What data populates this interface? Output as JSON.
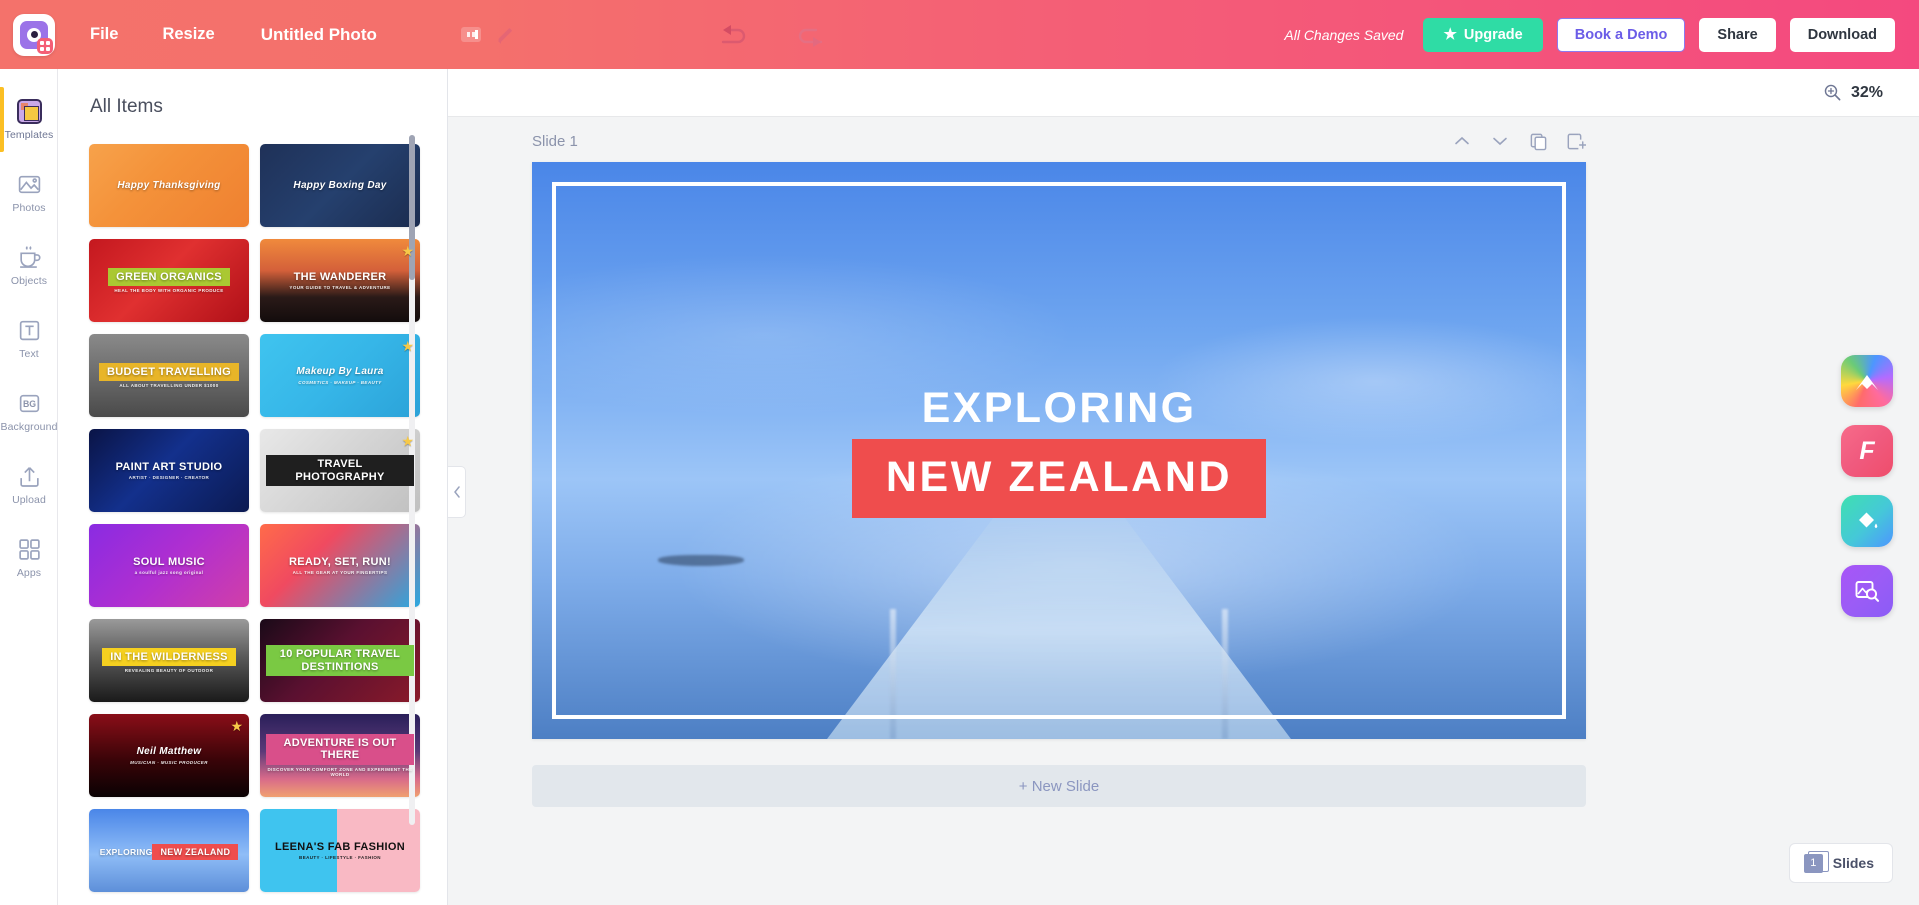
{
  "app": {
    "brand_color": "#f4597a",
    "logo_icon": "app-logo-icon"
  },
  "topbar": {
    "menu": [
      {
        "label": "File",
        "name": "menu-file"
      },
      {
        "label": "Resize",
        "name": "menu-resize"
      }
    ],
    "document_title": "Untitled Photo",
    "icons": {
      "film": "film-icon",
      "pencil": "pencil-icon",
      "undo": "undo-icon",
      "redo": "redo-icon"
    },
    "saved_status": "All Changes Saved",
    "upgrade_label": "Upgrade",
    "upgrade_star": "★",
    "demo_label": "Book a Demo",
    "share_label": "Share",
    "download_label": "Download"
  },
  "sidebar": {
    "items": [
      {
        "label": "Templates",
        "icon": "templates-icon",
        "active": true
      },
      {
        "label": "Photos",
        "icon": "photos-icon",
        "active": false
      },
      {
        "label": "Objects",
        "icon": "objects-icon",
        "active": false
      },
      {
        "label": "Text",
        "icon": "text-icon",
        "active": false
      },
      {
        "label": "Background",
        "icon": "background-icon",
        "active": false
      },
      {
        "label": "Upload",
        "icon": "upload-icon",
        "active": false
      },
      {
        "label": "Apps",
        "icon": "apps-icon",
        "active": false
      }
    ]
  },
  "panel": {
    "title": "All Items",
    "templates": [
      {
        "title": "Happy Thanksgiving",
        "sub": "",
        "starred": false,
        "bg": "linear-gradient(135deg,#f7a24b 0%,#f4923a 40%,#ef8030 100%)",
        "accent": "none",
        "style": "script"
      },
      {
        "title": "Happy Boxing Day",
        "sub": "",
        "starred": false,
        "bg": "linear-gradient(135deg,#1f3158 0%,#25406e 50%,#1b2c4f 100%)",
        "accent": "none",
        "style": "script"
      },
      {
        "title": "GREEN ORGANICS",
        "sub": "HEAL THE BODY WITH ORGANIC PRODUCE",
        "starred": false,
        "bg": "linear-gradient(135deg,#c4181f 0%,#e03030 45%,#b01018 100%)",
        "accent": "#aac832",
        "style": "band"
      },
      {
        "title": "THE WANDERER",
        "sub": "YOUR GUIDE TO TRAVEL & ADVENTURE",
        "starred": true,
        "bg": "linear-gradient(180deg,#f08a3c 0%,#d4603a 38%,#2a1a18 70%,#130c0c 100%)",
        "accent": "#e05a2b",
        "style": "outline"
      },
      {
        "title": "BUDGET TRAVELLING",
        "sub": "ALL ABOUT TRAVELLING UNDER $1000",
        "starred": false,
        "bg": "linear-gradient(180deg,#8a8a8a 0%,#6e6e6e 45%,#4a4a4a 100%)",
        "accent": "#e8b528",
        "style": "band"
      },
      {
        "title": "Makeup By Laura",
        "sub": "COSMETICS · MAKEUP · BEAUTY",
        "starred": true,
        "bg": "linear-gradient(135deg,#3fc4ef 0%,#36b6e8 50%,#2ba2d8 100%)",
        "accent": "none",
        "style": "serif"
      },
      {
        "title": "PAINT ART STUDIO",
        "sub": "ARTIST · DESIGNER · CREATOR",
        "starred": false,
        "bg": "linear-gradient(135deg,#0a1446 0%,#13308c 45%,#0b1a52 100%)",
        "accent": "none",
        "style": "plain"
      },
      {
        "title": "TRAVEL PHOTOGRAPHY",
        "sub": "",
        "starred": true,
        "bg": "linear-gradient(135deg,#e8e8e8 0%,#d4d4d4 50%,#c0c0c0 100%)",
        "accent": "#2c2c2c",
        "style": "band-dark"
      },
      {
        "title": "SOUL MUSIC",
        "sub": "a soulful jazz song original",
        "starred": false,
        "bg": "linear-gradient(135deg,#8a2be2 0%,#b02fd0 50%,#d13fa8 100%)",
        "accent": "none",
        "style": "plain"
      },
      {
        "title": "READY, SET, RUN!",
        "sub": "ALL THE GEAR AT YOUR FINGERTIPS",
        "starred": false,
        "bg": "linear-gradient(135deg,#ff6b4a 0%,#f04a60 35%,#2aa8e0 100%)",
        "accent": "#ffd93d",
        "style": "plain"
      },
      {
        "title": "IN THE WILDERNESS",
        "sub": "REVEALING BEAUTY OF OUTDOOR",
        "starred": false,
        "bg": "linear-gradient(180deg,#9a9a9a 0%,#5a5a5a 45%,#1a1a1a 100%)",
        "accent": "#f5d020",
        "style": "band"
      },
      {
        "title": "10 POPULAR TRAVEL DESTINTIONS",
        "sub": "",
        "starred": false,
        "bg": "linear-gradient(135deg,#1a0a18 0%,#5a1030 45%,#8a1a2a 100%)",
        "accent": "#7ac943",
        "style": "band"
      },
      {
        "title": "Neil Matthew",
        "sub": "MUSICIAN · MUSIC PRODUCER",
        "starred": true,
        "bg": "linear-gradient(180deg,#8a0e18 0%,#3a0408 55%,#0a0203 100%)",
        "accent": "#e8c84a",
        "style": "script"
      },
      {
        "title": "ADVENTURE IS OUT THERE",
        "sub": "DISCOVER YOUR COMFORT ZONE AND EXPERIMENT THE WORLD",
        "starred": false,
        "bg": "linear-gradient(180deg,#2a1f5a 0%,#5a3a78 45%,#d86a8a 78%,#f0a070 100%)",
        "accent": "#d94f8a",
        "style": "band"
      },
      {
        "title": "EXPLORING",
        "sub": "NEW ZEALAND",
        "starred": false,
        "bg": "linear-gradient(180deg,#4a86e8 0%,#8fbdf7 55%,#5d8fd9 100%)",
        "accent": "#ef4d4d",
        "style": "nz"
      },
      {
        "title": "LEENA'S FAB FASHION",
        "sub": "BEAUTY · LIFESTYLE · FASHION",
        "starred": false,
        "bg": "linear-gradient(90deg,#3fc4ef 0%,#3fc4ef 48%,#f9b9c4 48%,#f9b9c4 100%)",
        "accent": "none",
        "style": "plain-dark"
      }
    ]
  },
  "canvas": {
    "zoom_level": "32%",
    "zoom_icon": "zoom-in-icon",
    "slide_label": "Slide 1",
    "slide_tools": [
      {
        "name": "move-up-icon",
        "glyph": "chevron-up"
      },
      {
        "name": "move-down-icon",
        "glyph": "chevron-down"
      },
      {
        "name": "duplicate-slide-icon",
        "glyph": "copy"
      },
      {
        "name": "add-slide-icon",
        "glyph": "add-frame"
      }
    ],
    "new_slide_label": "+ New Slide",
    "slide_content": {
      "heading": "EXPLORING",
      "subheading": "NEW ZEALAND",
      "highlight_color": "#ef4d4d"
    }
  },
  "float_apps": [
    {
      "name": "color-palette-app",
      "icon": "palette-icon",
      "glyph": "M"
    },
    {
      "name": "fonts-app",
      "icon": "font-icon",
      "glyph": "F"
    },
    {
      "name": "fill-color-app",
      "icon": "paint-bucket-icon",
      "glyph": "bucket"
    },
    {
      "name": "image-search-app",
      "icon": "image-search-icon",
      "glyph": "imgsearch"
    }
  ],
  "statusbar": {
    "slides_count": "1",
    "slides_label": "Slides"
  }
}
